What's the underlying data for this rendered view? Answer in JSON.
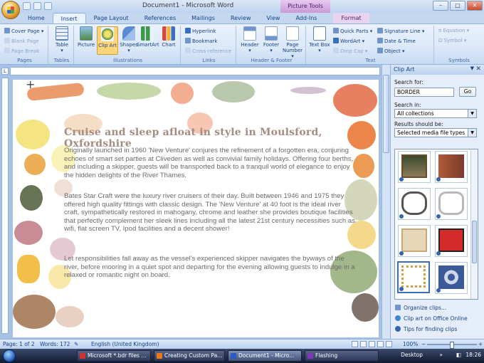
{
  "window": {
    "title": "Document1 - Microsoft Word",
    "contextual_tab": "Picture Tools",
    "controls": [
      "–",
      "□",
      "✕"
    ]
  },
  "tabs": [
    "Home",
    "Insert",
    "Page Layout",
    "References",
    "Mailings",
    "Review",
    "View",
    "Add-Ins",
    "Format"
  ],
  "ribbon": {
    "pages": {
      "label": "Pages",
      "items": [
        "Cover Page",
        "Blank Page",
        "Page Break"
      ]
    },
    "tables": {
      "label": "Tables",
      "table": "Table"
    },
    "illustrations": {
      "label": "Illustrations",
      "items": [
        "Picture",
        "Clip Art",
        "Shapes",
        "SmartArt",
        "Chart"
      ]
    },
    "links": {
      "label": "Links",
      "items": [
        "Hyperlink",
        "Bookmark",
        "Cross-reference"
      ]
    },
    "header_footer": {
      "label": "Header & Footer",
      "items": [
        "Header",
        "Footer",
        "Page Number"
      ]
    },
    "text": {
      "label": "Text",
      "text_box": "Text Box",
      "items": [
        "Quick Parts",
        "WordArt",
        "Drop Cap",
        "Signature Line",
        "Date & Time",
        "Object"
      ]
    },
    "symbols": {
      "label": "Symbols",
      "items": [
        "Equation",
        "Symbol"
      ]
    }
  },
  "document": {
    "heading": "Cruise and sleep afloat in style in Moulsford, Oxfordshire",
    "paragraphs": [
      "Originally launched in 1960 'New Venture' conjures the refinement of a forgotten era, conjuring echoes of smart set parties at Cliveden as well as convivial family holidays. Offering four berths, and including a skipper, guests will be transported back to a tranquil world of elegance to enjoy the hidden delights of the River Thames.",
      "Bates Star Craft were the luxury river cruisers of their day. Built between 1946 and 1975 they offered high quality fittings with classic design. The 'New Venture' at 40 foot is the ideal river craft, sympathetically restored in mahogany, chrome and leather she provides boutique facilities that perfectly complement her sleek lines including all the latest 21st century necessities such as wifi, flat screen TV, Ipod facilities and a decent shower!",
      "Let responsibilities fall away as the vessel's experienced skipper navigates the byways of the river, before mooring in a quiet spot and departing for the evening allowing guests to indulge in a relaxed or romantic night on board."
    ]
  },
  "clipart_pane": {
    "title": "Clip Art",
    "search_for_label": "Search for:",
    "search_value": "BORDER",
    "go_label": "Go",
    "search_in_label": "Search in:",
    "search_in_value": "All collections",
    "results_label": "Results should be:",
    "results_value": "Selected media file types",
    "links": [
      "Organize clips...",
      "Clip art on Office Online",
      "Tips for finding clips"
    ]
  },
  "statusbar": {
    "page": "Page: 1 of 2",
    "words": "Words: 172",
    "language": "English (United Kingdom)",
    "zoom": "100%"
  },
  "taskbar": {
    "items": [
      "Microsoft *.bdr files ...",
      "Creating Custom Pa...",
      "Document1 - Micro...",
      "Flashing"
    ],
    "desktop": "Desktop",
    "clock": "18:26"
  }
}
